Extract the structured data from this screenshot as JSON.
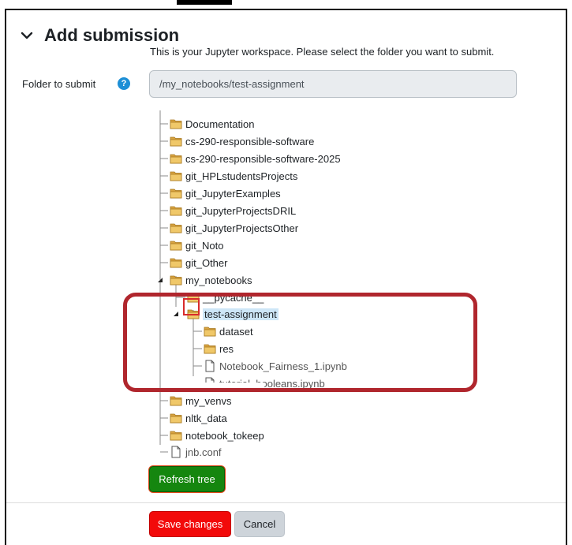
{
  "form": {
    "title": "Add submission",
    "intro": "This is your Jupyter workspace. Please select the folder you want to submit.",
    "folder_label": "Folder to submit",
    "help_icon": "?",
    "folder_value": "/my_notebooks/test-assignment"
  },
  "tree": [
    {
      "label": "Documentation",
      "type": "folder"
    },
    {
      "label": "cs-290-responsible-software",
      "type": "folder"
    },
    {
      "label": "cs-290-responsible-software-2025",
      "type": "folder"
    },
    {
      "label": "git_HPLstudentsProjects",
      "type": "folder"
    },
    {
      "label": "git_JupyterExamples",
      "type": "folder"
    },
    {
      "label": "git_JupyterProjectsDRIL",
      "type": "folder"
    },
    {
      "label": "git_JupyterProjectsOther",
      "type": "folder"
    },
    {
      "label": "git_Noto",
      "type": "folder"
    },
    {
      "label": "git_Other",
      "type": "folder"
    },
    {
      "label": "my_notebooks",
      "type": "folder",
      "expanded": true
    },
    {
      "label": "__pycache__",
      "type": "folder"
    },
    {
      "label": "test-assignment",
      "type": "folder",
      "expanded": true,
      "selected": true
    },
    {
      "label": "dataset",
      "type": "folder"
    },
    {
      "label": "res",
      "type": "folder"
    },
    {
      "label": "Notebook_Fairness_1.ipynb",
      "type": "file"
    },
    {
      "label": "tutorial_booleans.ipynb",
      "type": "file"
    },
    {
      "label": "my_venvs",
      "type": "folder"
    },
    {
      "label": "nltk_data",
      "type": "folder"
    },
    {
      "label": "notebook_tokeep",
      "type": "folder"
    },
    {
      "label": "jnb.conf",
      "type": "file"
    }
  ],
  "buttons": {
    "refresh": "Refresh tree",
    "save": "Save changes",
    "cancel": "Cancel"
  },
  "colors": {
    "refresh_bg": "#15860f",
    "save_bg": "#f20a0a",
    "highlight_border": "#b0262d",
    "help_icon_bg": "#1d8fd6"
  }
}
